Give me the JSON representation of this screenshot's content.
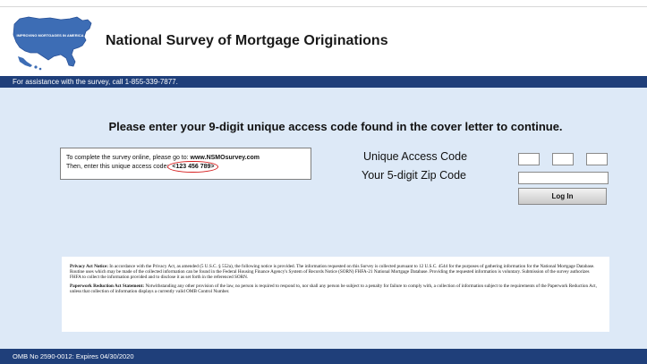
{
  "header": {
    "logo_text": "IMPROVING MORTGAGES IN AMERICA",
    "title": "National Survey of Mortgage Originations"
  },
  "assistance": {
    "text": "For assistance with the survey, call 1-855-339-7877."
  },
  "main": {
    "instruction": "Please enter your 9-digit unique access code found in the cover letter to continue."
  },
  "code_box": {
    "line1_prefix": "To complete the survey online, please go to:",
    "url": "www.NSMOsurvey.com",
    "line2_prefix": "Then, enter this unique access code:",
    "example_code": "<123 456 789>"
  },
  "form": {
    "access_code_label": "Unique Access Code",
    "zip_label": "Your 5-digit Zip Code",
    "login_label": "Log In",
    "access_code_parts": [
      "",
      "",
      ""
    ],
    "zip_value": ""
  },
  "notice": {
    "privacy_title": "Privacy Act Notice:",
    "privacy_text": "In accordance with the Privacy Act, as amended (5 U.S.C. § 552a), the following notice is provided. The information requested on this Survey is collected pursuant to 12 U.S.C. 4544 for the purposes of gathering information for the National Mortgage Database. Routine uses which may be made of the collected information can be found in the Federal Housing Finance Agency's System of Records Notice (SORN) FHFA-21 National Mortgage Database. Providing the requested information is voluntary. Submission of the survey authorizes FHFA to collect the information provided and to disclose it as set forth in the referenced SORN.",
    "paperwork_title": "Paperwork Reduction Act Statement:",
    "paperwork_text": "Notwithstanding any other provision of the law, no person is required to respond to, nor shall any person be subject to a penalty for failure to comply with, a collection of information subject to the requirements of the Paperwork Reduction Act, unless that collection of information displays a currently valid OMB Control Number."
  },
  "footer": {
    "text": "OMB No 2590-0012:  Expires 04/30/2020"
  },
  "colors": {
    "brand_blue": "#1f3f7a",
    "page_background": "#dde9f7",
    "map_blue": "#3d6db5",
    "highlight_red": "#d62020"
  }
}
